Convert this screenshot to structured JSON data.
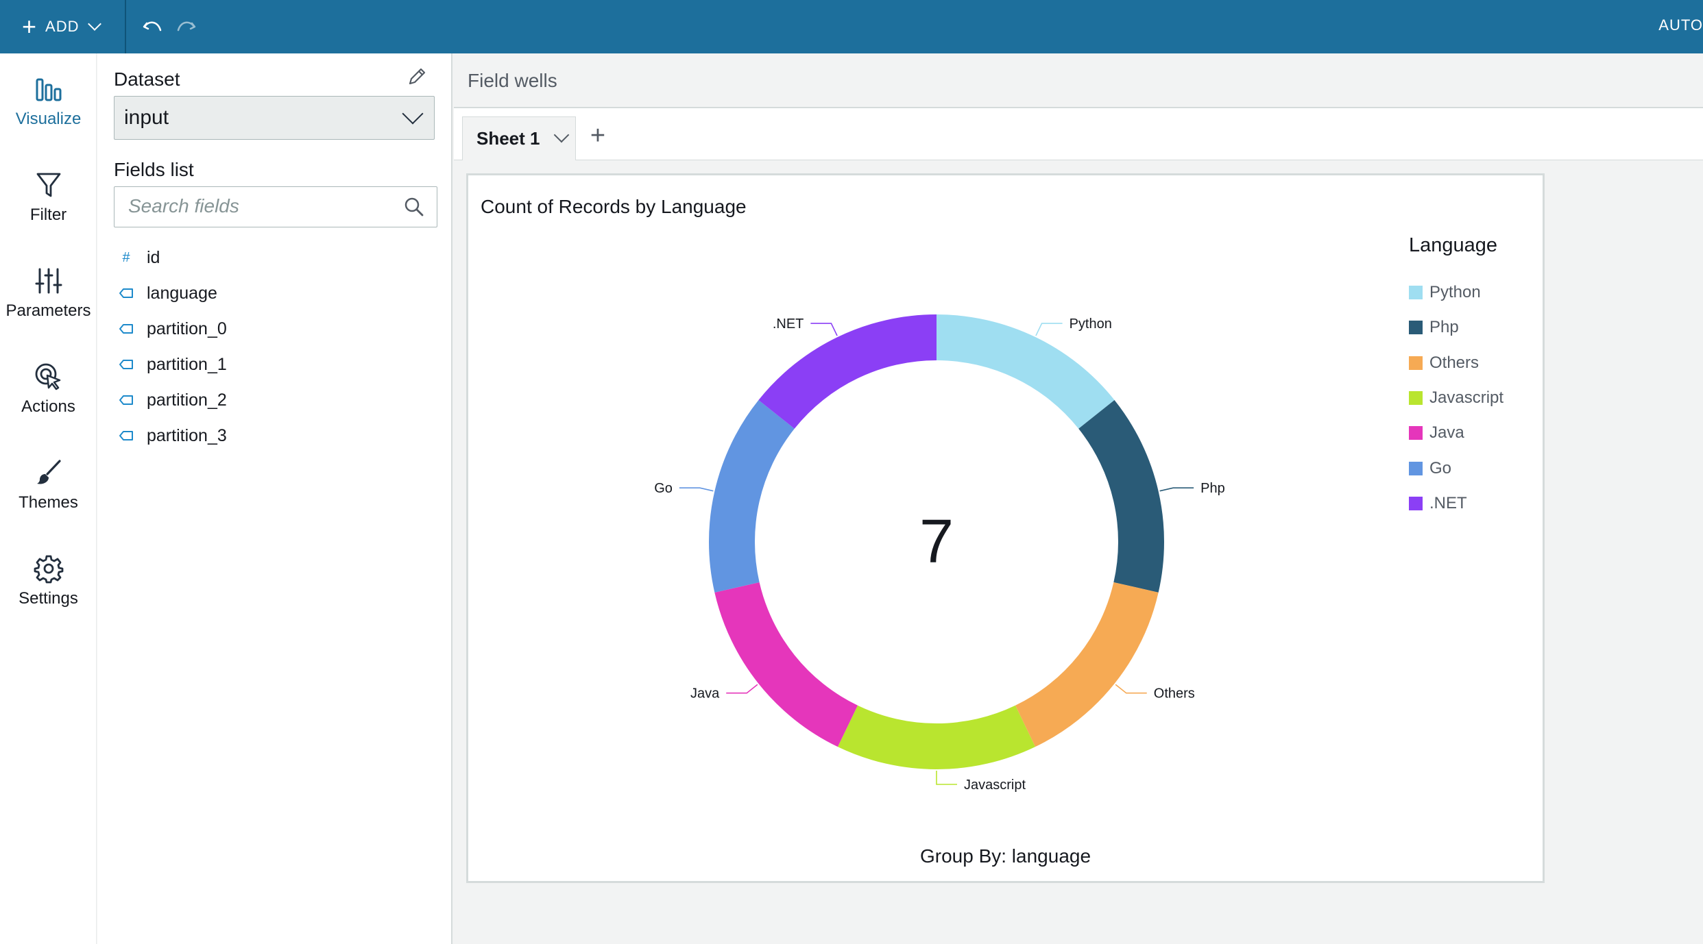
{
  "topbar": {
    "add_label": "ADD",
    "auto_label": "AUTO"
  },
  "nav": [
    {
      "key": "visualize",
      "label": "Visualize",
      "icon": "bar-chart-icon"
    },
    {
      "key": "filter",
      "label": "Filter",
      "icon": "funnel-icon"
    },
    {
      "key": "parameters",
      "label": "Parameters",
      "icon": "sliders-icon"
    },
    {
      "key": "actions",
      "label": "Actions",
      "icon": "cursor-click-icon"
    },
    {
      "key": "themes",
      "label": "Themes",
      "icon": "paintbrush-icon"
    },
    {
      "key": "settings",
      "label": "Settings",
      "icon": "gear-icon"
    }
  ],
  "dataset": {
    "title": "Dataset",
    "selected": "input"
  },
  "fields": {
    "title": "Fields list",
    "search_placeholder": "Search fields",
    "items": [
      {
        "name": "id",
        "type": "numeric"
      },
      {
        "name": "language",
        "type": "dimension"
      },
      {
        "name": "partition_0",
        "type": "dimension"
      },
      {
        "name": "partition_1",
        "type": "dimension"
      },
      {
        "name": "partition_2",
        "type": "dimension"
      },
      {
        "name": "partition_3",
        "type": "dimension"
      }
    ]
  },
  "field_wells_label": "Field wells",
  "sheet_tab": "Sheet 1",
  "visual": {
    "title": "Count of Records by Language",
    "group_by": "Group By: language",
    "center_total": "7"
  },
  "chart_data": {
    "type": "pie",
    "style": "donut",
    "title": "Count of Records by Language",
    "legend_title": "Language",
    "legend_position": "right",
    "total": 7,
    "categories": [
      "Python",
      "Php",
      "Others",
      "Javascript",
      "Java",
      "Go",
      ".NET"
    ],
    "values": [
      1,
      1,
      1,
      1,
      1,
      1,
      1
    ],
    "colors": [
      "#9fdef1",
      "#2a5b77",
      "#f6aa54",
      "#b9e52f",
      "#e536bb",
      "#6195e1",
      "#8b3ff5"
    ]
  }
}
